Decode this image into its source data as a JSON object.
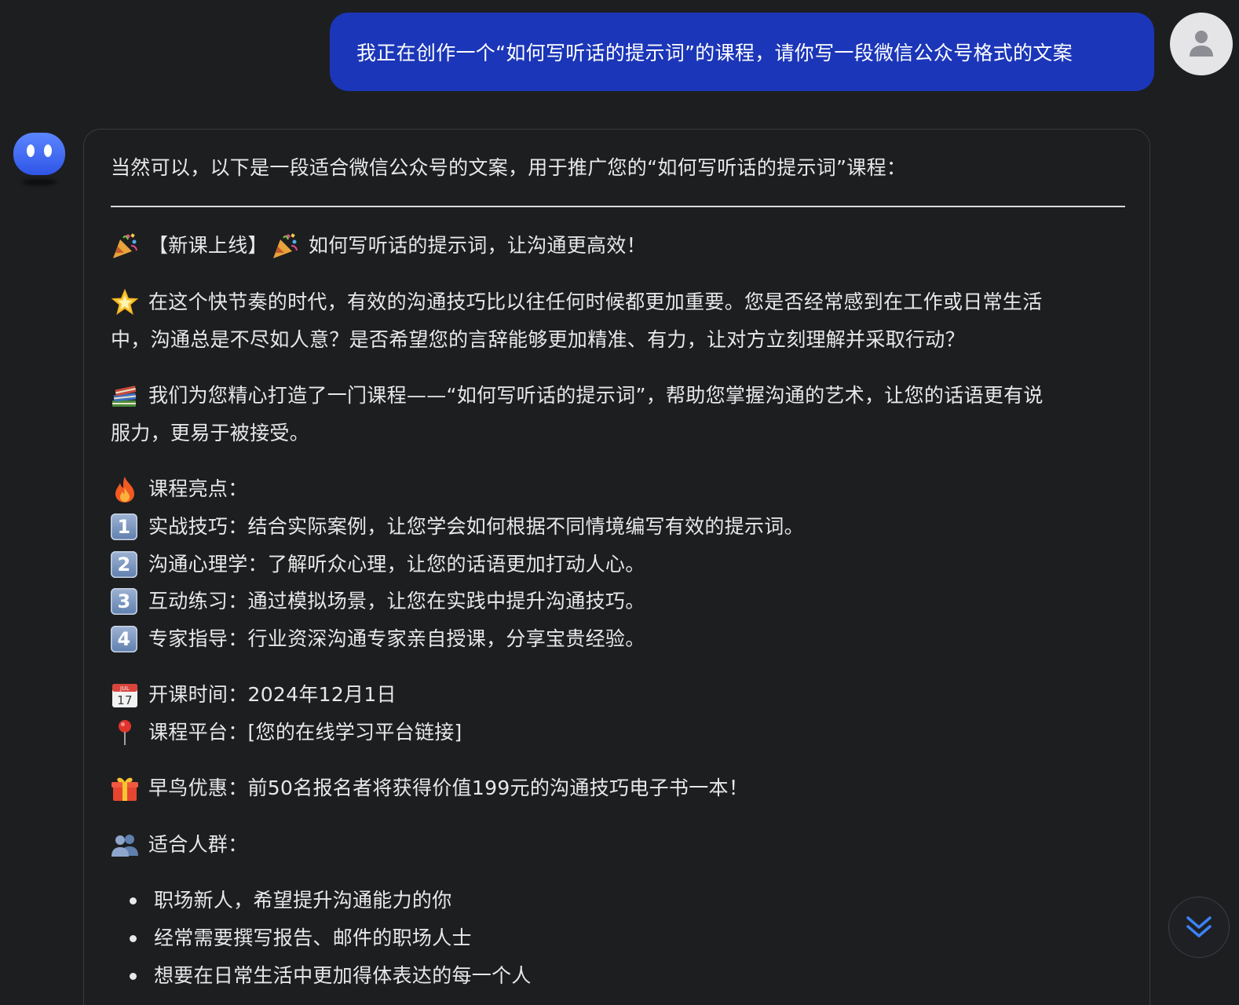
{
  "user_message": {
    "text": "我正在创作一个“如何写听话的提示词”的课程，请你写一段微信公众号格式的文案",
    "avatar_icon": "user-avatar-icon",
    "bubble_color": "#1b36b8"
  },
  "assistant_message": {
    "avatar_icon": "bot-avatar-icon",
    "avatar_color": "#3a6bf2",
    "intro": "当然可以，以下是一段适合微信公众号的文案，用于推广您的“如何写听话的提示词”课程：",
    "headline": "【新课上线】",
    "headline_tail": "如何写听话的提示词，让沟通更高效！",
    "para1_line1": "在这个快节奏的时代，有效的沟通技巧比以往任何时候都更加重要。您是否经常感到在工作或日常生活",
    "para1_line2": "中，沟通总是不尽如人意？是否希望您的言辞能够更加精准、有力，让对方立刻理解并采取行动？",
    "para2_line1": "我们为您精心打造了一门课程——“如何写听话的提示词”，帮助您掌握沟通的艺术，让您的话语更有说",
    "para2_line2": "服力，更易于被接受。",
    "highlights_title": "课程亮点：",
    "highlights": [
      {
        "num": "1",
        "text": "实战技巧：结合实际案例，让您学会如何根据不同情境编写有效的提示词。"
      },
      {
        "num": "2",
        "text": "沟通心理学：了解听众心理，让您的话语更加打动人心。"
      },
      {
        "num": "3",
        "text": "互动练习：通过模拟场景，让您在实践中提升沟通技巧。"
      },
      {
        "num": "4",
        "text": "专家指导：行业资深沟通专家亲自授课，分享宝贵经验。"
      }
    ],
    "calendar_day": "17",
    "calendar_month": "JUL",
    "start_time": "开课时间：2024年12月1日",
    "platform": "课程平台：[您的在线学习平台链接]",
    "early_bird": "早鸟优惠：前50名报名者将获得价值199元的沟通技巧电子书一本！",
    "audience_title": "适合人群：",
    "audience": [
      "职场新人，希望提升沟通能力的你",
      "经常需要撰写报告、邮件的职场人士",
      "想要在日常生活中更加得体表达的每一个人"
    ]
  },
  "scroll_button": {
    "icon": "double-chevron-down-icon",
    "color": "#3b82f6"
  }
}
